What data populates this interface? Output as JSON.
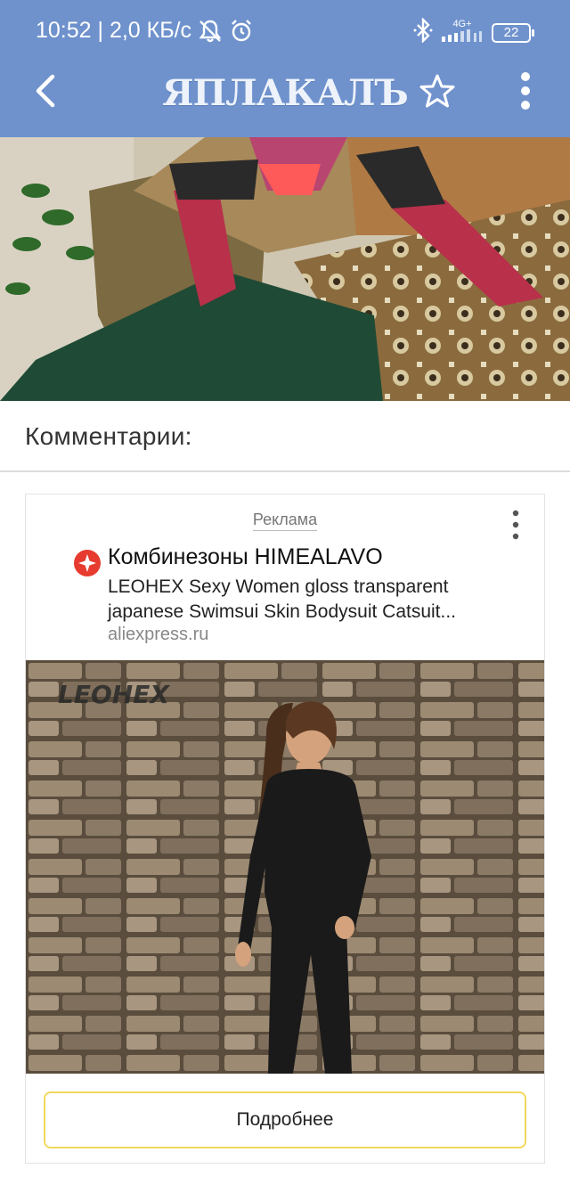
{
  "status_bar": {
    "time_speed": "10:52 | 2,0 КБ/с",
    "network": "4G+",
    "battery": "22"
  },
  "toolbar": {
    "logo": "ЯПЛАКАЛЪ",
    "icons": [
      "back-arrow-icon",
      "star-icon",
      "more-vertical-icon"
    ]
  },
  "comments": {
    "title": "Комментарии:"
  },
  "ad": {
    "label": "Реклама",
    "title": "Комбинезоны HIMEALAVO",
    "description": "LEOHEX Sexy Women gloss transparent japanese Swimsui Skin Bodysuit Catsuit...",
    "domain": "aliexpress.ru",
    "image_brand": "LEOHEX",
    "cta": "Подробнее"
  },
  "colors": {
    "appbar": "#6f92cd",
    "cta_border": "#f2d95c",
    "brand_icon": "#e63b2e"
  }
}
